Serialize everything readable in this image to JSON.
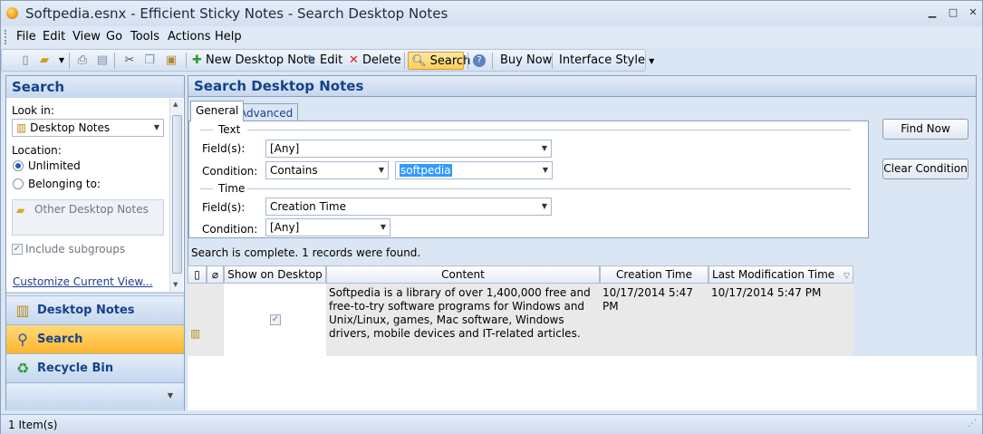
{
  "window": {
    "title": "Softpedia.esnx - Efficient Sticky Notes - Search Desktop Notes"
  },
  "menu": [
    "File",
    "Edit",
    "View",
    "Go",
    "Tools",
    "Actions",
    "Help"
  ],
  "toolbar": {
    "new_note": "New Desktop Note",
    "edit": "Edit",
    "delete": "Delete",
    "search": "Search",
    "buy_now": "Buy Now",
    "interface_style": "Interface Style"
  },
  "left": {
    "header": "Search",
    "look_in_label": "Look in:",
    "look_in_value": "Desktop Notes",
    "location_label": "Location:",
    "radio_unlimited": "Unlimited",
    "radio_belonging": "Belonging to:",
    "folder_placeholder": "Other Desktop Notes",
    "include_subgroups": "Include subgroups",
    "customize_link": "Customize Current View...",
    "nav": [
      {
        "label": "Desktop Notes",
        "icon": "notes-icon"
      },
      {
        "label": "Search",
        "icon": "search-icon"
      },
      {
        "label": "Recycle Bin",
        "icon": "recycle-icon"
      }
    ]
  },
  "right": {
    "header": "Search Desktop Notes",
    "tabs": [
      "General",
      "Advanced"
    ],
    "text_group": "Text",
    "fields_label": "Field(s):",
    "fields_value": "[Any]",
    "condition_label": "Condition:",
    "condition_value": "Contains",
    "search_text": "softpedia",
    "time_group": "Time",
    "time_fields_value": "Creation Time",
    "time_condition_value": "[Any]",
    "find_now": "Find Now",
    "clear_condition": "Clear Condition",
    "status": "Search is complete. 1 records were found."
  },
  "grid": {
    "columns": [
      "",
      "",
      "Show on Desktop",
      "Content",
      "Creation Time",
      "Last Modification Time"
    ],
    "rows": [
      {
        "content": "Softpedia is a library of over 1,400,000 free and free-to-try software programs for Windows and Unix/Linux, games, Mac software, Windows drivers, mobile devices and IT-related articles.",
        "creation_time": "10/17/2014 5:47 PM",
        "modification_time": "10/17/2014 5:47 PM",
        "show_on_desktop": true
      }
    ]
  },
  "statusbar": {
    "text": "1 Item(s)"
  }
}
